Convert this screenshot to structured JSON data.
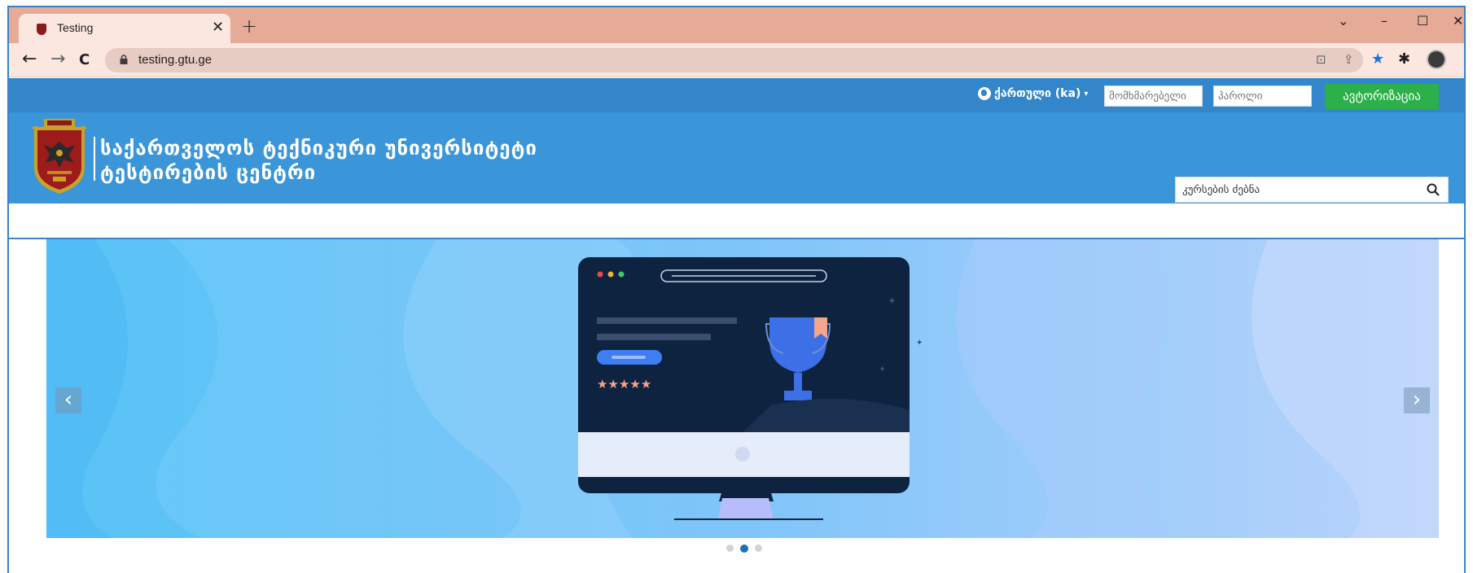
{
  "browser": {
    "tab_title": "Testing",
    "tab_close": "✕",
    "new_tab": "+",
    "url": "testing.gtu.ge",
    "window_controls": {
      "chevron": "⌄",
      "minimize": "–",
      "maximize": "☐",
      "close": "✕"
    },
    "nav": {
      "back": "←",
      "forward": "→",
      "reload": "C"
    }
  },
  "topbar": {
    "language_label": "ქართული (ka)",
    "language_caret": "▾",
    "username_placeholder": "მომხმარებელი",
    "password_placeholder": "პაროლი",
    "login_label": "ავტორიზაცია"
  },
  "header": {
    "title_line1": "საქართველოს ტექნიკური უნივერსიტეტი",
    "title_line2": "ტესტირების ცენტრი",
    "search_placeholder": "კურსების ძებნა"
  },
  "carousel": {
    "prev_label": "‹",
    "next_label": "›",
    "slide_count": 3,
    "active_slide": 2,
    "rating_stars": 5
  },
  "colors": {
    "tabbar": "#e6ab96",
    "topbar": "#3386c9",
    "header": "#3a96d9",
    "login_button": "#2bb04a",
    "carousel_bg": "#76c6f7",
    "monitor_screen": "#0d2340"
  },
  "icons": [
    "back-icon",
    "forward-icon",
    "reload-icon",
    "lock-icon",
    "translate-icon",
    "share-icon",
    "star-icon",
    "puzzle-icon",
    "menu-icon",
    "globe-icon",
    "search-icon",
    "trophy-icon"
  ]
}
